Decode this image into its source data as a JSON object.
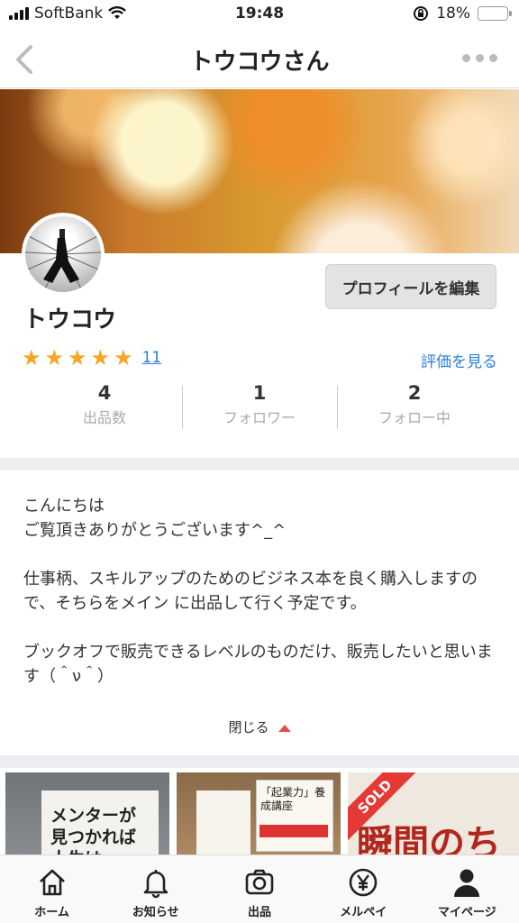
{
  "status_bar": {
    "carrier": "SoftBank",
    "time": "19:48",
    "battery": "18%",
    "battery_level": 0.18,
    "battery_color": "#e53935"
  },
  "nav": {
    "title": "トウコウさん"
  },
  "profile": {
    "edit_button": "プロフィールを編集",
    "name": "トウコウ",
    "rating": 5,
    "review_count": "11",
    "review_link": "評価を見る",
    "stats": [
      {
        "num": "4",
        "label": "出品数"
      },
      {
        "num": "1",
        "label": "フォロワー"
      },
      {
        "num": "2",
        "label": "フォロー中"
      }
    ]
  },
  "bio": {
    "lines": [
      "こんにちは\nご覧頂きありがとうございます^_^",
      "仕事柄、スキルアップのためのビジネス本を良く購入しますので、そちらをメイン に出品して行く予定です。",
      "ブックオフで販売できるレベルのものだけ、販売したいと思います（＾ν＾）"
    ],
    "close_label": "閉じる"
  },
  "items": [
    {
      "cover_text": "メンターが\n見つかれば\n人生は"
    },
    {
      "cover_text": "「起業力」養成講座"
    },
    {
      "badge": "SOLD",
      "cover_text": "瞬間のちか"
    }
  ],
  "tabs": [
    {
      "label": "ホーム",
      "icon": "home-icon"
    },
    {
      "label": "お知らせ",
      "icon": "bell-icon"
    },
    {
      "label": "出品",
      "icon": "camera-icon"
    },
    {
      "label": "メルペイ",
      "icon": "yen-icon"
    },
    {
      "label": "マイページ",
      "icon": "person-icon"
    }
  ],
  "colors": {
    "accent": "#2b7fd8",
    "star": "#f5a623",
    "sold": "#e53935"
  }
}
